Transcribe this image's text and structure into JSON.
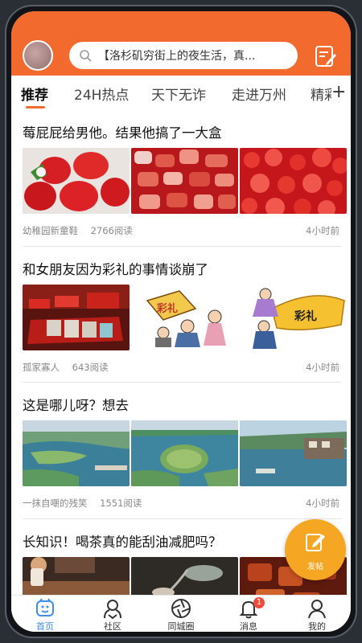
{
  "search": {
    "placeholder_text": "【洛杉矶穷街上的夜生活，真..."
  },
  "tabs": [
    {
      "label": "推荐",
      "active": true
    },
    {
      "label": "24H热点",
      "active": false
    },
    {
      "label": "天下无诈",
      "active": false
    },
    {
      "label": "走进万州",
      "active": false
    },
    {
      "label": "精彩",
      "active": false
    }
  ],
  "feed": [
    {
      "title": "莓屁屁给男他。结果他搞了一大盒",
      "author": "幼稚园新童鞋",
      "reads": "2766阅读",
      "time": "4小时前"
    },
    {
      "title": "和女朋友因为彩礼的事情谈崩了",
      "author": "孤家寡人",
      "reads": "643阅读",
      "time": "4小时前"
    },
    {
      "title": "这是哪儿呀？想去",
      "author": "一抹自嘲的残笑",
      "reads": "1551阅读",
      "time": "4小时前"
    },
    {
      "title": "长知识！喝茶真的能刮油减肥吗？",
      "author": "",
      "reads": "",
      "time": ""
    }
  ],
  "thumb_texts": {
    "caili": "彩礼"
  },
  "fab": {
    "label": "发帖"
  },
  "bottom_nav": [
    {
      "label": "首页",
      "active": true
    },
    {
      "label": "社区",
      "active": false
    },
    {
      "label": "同城圈",
      "active": false
    },
    {
      "label": "消息",
      "active": false,
      "badge": "1"
    },
    {
      "label": "我的",
      "active": false
    }
  ],
  "colors": {
    "brand": "#f26a2e",
    "fab": "#f5a623",
    "active_nav": "#3b8de6",
    "badge": "#f04b3a"
  }
}
